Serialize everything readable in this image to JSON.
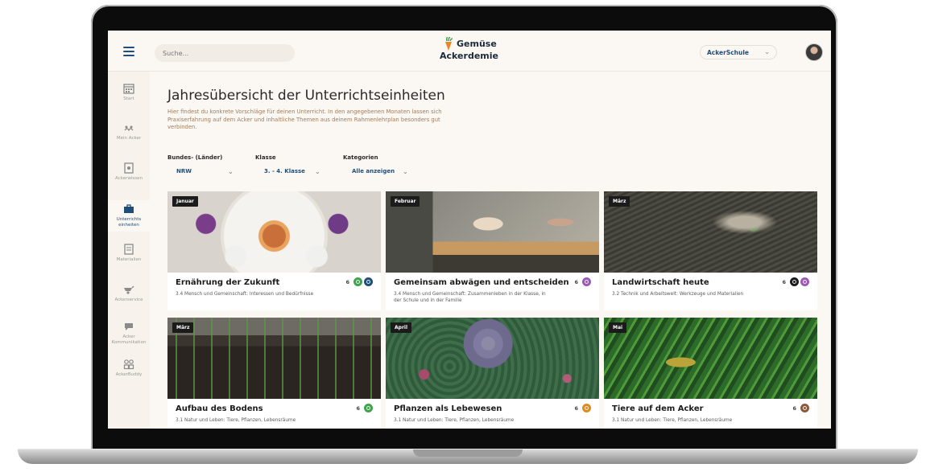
{
  "header": {
    "search_placeholder": "Suche...",
    "logo_line1": "Gemüse",
    "logo_line2": "Ackerdemie",
    "school_select": "AckerSchule"
  },
  "sidebar": {
    "items": [
      {
        "label": "Start"
      },
      {
        "label": "Mein Acker"
      },
      {
        "label": "Ackerwissen"
      },
      {
        "label": "Unterrichts einheiten"
      },
      {
        "label": "Materialien"
      },
      {
        "label": "Ackerservice"
      },
      {
        "label": "Acker Kommunikation"
      },
      {
        "label": "AckerBuddy"
      }
    ]
  },
  "page": {
    "title": "Jahresübersicht der Unterrichtseinheiten",
    "description": "Hier findest du konkrete Vorschläge für deinen Unterricht. In den angegebenen Monaten lassen sich Praxiserfahrung auf dem Acker und inhaltliche Themen aus deinem Rahmenlehrplan besonders gut verbinden."
  },
  "filters": [
    {
      "label": "Bundes- (Länder)",
      "value": "NRW"
    },
    {
      "label": "Klasse",
      "value": "3. - 4. Klasse"
    },
    {
      "label": "Kategorien",
      "value": "Alle anzeigen"
    }
  ],
  "cards": [
    {
      "month": "Januar",
      "title": "Ernährung der Zukunft",
      "subtitle": "3.4 Mensch und Gemeinschaft: Interessen und Bedürfnisse",
      "count": "6",
      "badge_colors": [
        "#3fa34d",
        "#1f4e79"
      ]
    },
    {
      "month": "Februar",
      "title": "Gemeinsam abwägen und entscheiden",
      "subtitle": "3.4 Mensch und Gemeinschaft: Zusammenleben in der Klasse, in der Schule und in der Familie",
      "count": "6",
      "badge_colors": [
        "#9b59b6"
      ]
    },
    {
      "month": "März",
      "title": "Landwirtschaft heute",
      "subtitle": "3.2 Technik und Arbeitswelt: Werkzeuge und Materialien",
      "count": "6",
      "badge_colors": [
        "#1c1c1c",
        "#9b59b6"
      ]
    },
    {
      "month": "März",
      "title": "Aufbau des Bodens",
      "subtitle": "3.1 Natur und Leben: Tiere, Pflanzen, Lebensräume",
      "count": "6",
      "badge_colors": [
        "#3fa34d"
      ]
    },
    {
      "month": "April",
      "title": "Pflanzen als Lebewesen",
      "subtitle": "3.1 Natur und Leben: Tiere, Pflanzen, Lebensräume",
      "count": "6",
      "badge_colors": [
        "#e08a1e"
      ]
    },
    {
      "month": "Mai",
      "title": "Tiere auf dem Acker",
      "subtitle": "3.1 Natur und Leben: Tiere, Pflanzen, Lebensräume",
      "count": "6",
      "badge_colors": [
        "#8a5a3c"
      ]
    }
  ]
}
